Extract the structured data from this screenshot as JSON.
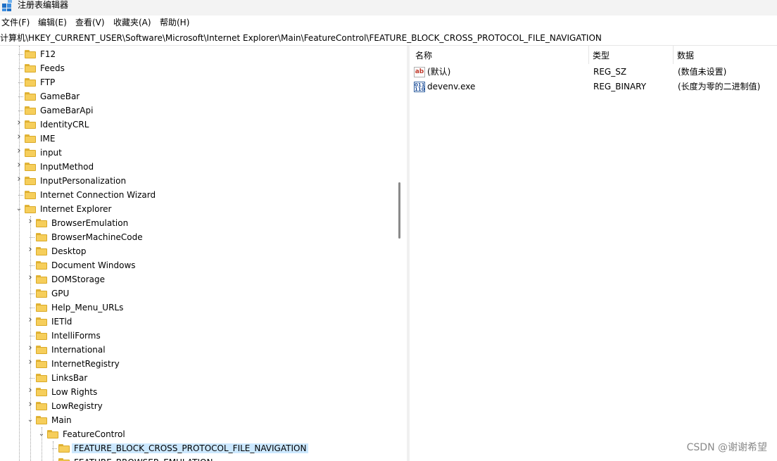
{
  "window": {
    "title": "注册表编辑器",
    "accent": "#0078d4"
  },
  "menu": [
    {
      "label": "文件(F)"
    },
    {
      "label": "编辑(E)"
    },
    {
      "label": "查看(V)"
    },
    {
      "label": "收藏夹(A)"
    },
    {
      "label": "帮助(H)"
    }
  ],
  "address": "计算机\\HKEY_CURRENT_USER\\Software\\Microsoft\\Internet Explorer\\Main\\FeatureControl\\FEATURE_BLOCK_CROSS_PROTOCOL_FILE_NAVIGATION",
  "tree": [
    {
      "label": "F12",
      "level": 0,
      "chev": ""
    },
    {
      "label": "Feeds",
      "level": 0,
      "chev": ""
    },
    {
      "label": "FTP",
      "level": 0,
      "chev": ""
    },
    {
      "label": "GameBar",
      "level": 0,
      "chev": ""
    },
    {
      "label": "GameBarApi",
      "level": 0,
      "chev": ""
    },
    {
      "label": "IdentityCRL",
      "level": 0,
      "chev": "collapsed"
    },
    {
      "label": "IME",
      "level": 0,
      "chev": "collapsed"
    },
    {
      "label": "input",
      "level": 0,
      "chev": "collapsed"
    },
    {
      "label": "InputMethod",
      "level": 0,
      "chev": "collapsed"
    },
    {
      "label": "InputPersonalization",
      "level": 0,
      "chev": "collapsed"
    },
    {
      "label": "Internet Connection Wizard",
      "level": 0,
      "chev": ""
    },
    {
      "label": "Internet Explorer",
      "level": 0,
      "chev": "expanded"
    },
    {
      "label": "BrowserEmulation",
      "level": 1,
      "chev": "collapsed"
    },
    {
      "label": "BrowserMachineCode",
      "level": 1,
      "chev": ""
    },
    {
      "label": "Desktop",
      "level": 1,
      "chev": "collapsed"
    },
    {
      "label": "Document Windows",
      "level": 1,
      "chev": ""
    },
    {
      "label": "DOMStorage",
      "level": 1,
      "chev": "collapsed"
    },
    {
      "label": "GPU",
      "level": 1,
      "chev": ""
    },
    {
      "label": "Help_Menu_URLs",
      "level": 1,
      "chev": ""
    },
    {
      "label": "IETld",
      "level": 1,
      "chev": "collapsed"
    },
    {
      "label": "IntelliForms",
      "level": 1,
      "chev": ""
    },
    {
      "label": "International",
      "level": 1,
      "chev": "collapsed"
    },
    {
      "label": "InternetRegistry",
      "level": 1,
      "chev": "collapsed"
    },
    {
      "label": "LinksBar",
      "level": 1,
      "chev": ""
    },
    {
      "label": "Low Rights",
      "level": 1,
      "chev": "collapsed"
    },
    {
      "label": "LowRegistry",
      "level": 1,
      "chev": "collapsed"
    },
    {
      "label": "Main",
      "level": 1,
      "chev": "expanded"
    },
    {
      "label": "FeatureControl",
      "level": 2,
      "chev": "expanded"
    },
    {
      "label": "FEATURE_BLOCK_CROSS_PROTOCOL_FILE_NAVIGATION",
      "level": 3,
      "chev": "",
      "selected": true
    },
    {
      "label": "FEATURE_BROWSER_EMULATION",
      "level": 3,
      "chev": ""
    }
  ],
  "list": {
    "headers": {
      "name": "名称",
      "type": "类型",
      "data": "数据"
    },
    "rows": [
      {
        "icon": "string-value-icon",
        "glyph": "ab",
        "name": "(默认)",
        "type": "REG_SZ",
        "data": "(数值未设置)"
      },
      {
        "icon": "binary-value-icon",
        "glyph": "011 110",
        "name": "devenv.exe",
        "type": "REG_BINARY",
        "data": "(长度为零的二进制值)"
      }
    ]
  },
  "watermark": "CSDN @谢谢希望",
  "colors": {
    "selection": "#cce8ff",
    "folder": "#f6ce5b"
  }
}
